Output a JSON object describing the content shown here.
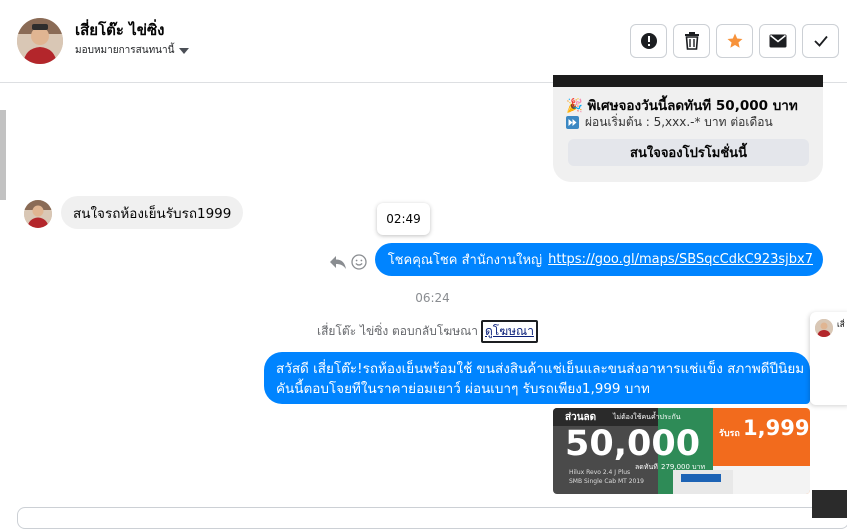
{
  "header": {
    "contact_name": "เสี่ยโต๊ะ ไข่ซิ่ง",
    "assign_label": "มอบหมายการสนทนานี้",
    "actions": [
      {
        "name": "spam-button",
        "icon": "alert-circle-icon"
      },
      {
        "name": "delete-button",
        "icon": "trash-icon"
      },
      {
        "name": "star-button",
        "icon": "star-icon",
        "color": "#f7923a"
      },
      {
        "name": "mark-unread-button",
        "icon": "envelope-icon"
      },
      {
        "name": "mark-done-button",
        "icon": "checkmark-icon"
      }
    ]
  },
  "promo_card": {
    "line1": "พิเศษจองวันนี้ลดทันที 50,000 บาท",
    "line2": "ผ่อนเริ่มต้น : 5,xxx.-* บาท ต่อเดือน",
    "cta": "สนใจจองโปรโมชั่นนี้",
    "line1_icon": "party-popper-icon",
    "line2_icon": "fast-forward-icon"
  },
  "messages": {
    "incoming_1": "สนใจรถห้องเย็นรับรถ1999",
    "tooltip_time": "02:49",
    "outgoing_1_text": "โชคคุณโชค สำนักงานใหญ่",
    "outgoing_1_link": "https://goo.gl/maps/SBSqcCdkC923sjbx7",
    "time_divider": "06:24",
    "system_text": "เสี่ยโต๊ะ ไข่ซิ่ง ตอบกลับโฆษณา",
    "system_link": "ดูโฆษณา",
    "outgoing_2_line1": "สวัสดี เสี่ยโต๊ะ!รถห้องเย็นพร้อมใช้ ขนส่งสินค้าแช่เย็นและขนส่งอาหารแช่แข็ง สภาพดีปีนิยม",
    "outgoing_2_line2": "คันนี้ตอบโจยทีในราคาย่อมเยาว์ ผ่อนเบาๆ รับรถเพียง1,999 บาท"
  },
  "ad_image": {
    "tag": "ส่วนลด",
    "subtag": "ไม่ต้องใช้คนค้ำประกัน",
    "big_number": "50,000",
    "small_text": "ลดทันที",
    "model_line1": "Hilux Revo 2.4 J Plus",
    "model_line2": "SMB Single Cab MT 2019",
    "right_label": "รับรถ",
    "right_price": "1,999",
    "price_detail": "279,000 บาท"
  },
  "mini_head": {
    "name": "เสี่"
  },
  "colors": {
    "accent_blue": "#0084ff",
    "bubble_gray": "#f0f0f0",
    "star_orange": "#f7923a"
  }
}
